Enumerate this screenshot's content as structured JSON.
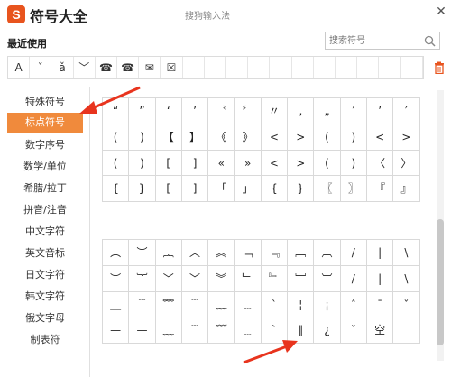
{
  "app": {
    "logo_letter": "S",
    "title": "符号大全",
    "window_title": "搜狗输入法",
    "close_symbol": "✕"
  },
  "recent": {
    "label": "最近使用",
    "items": [
      "A",
      "ˇ",
      "ǎ",
      "﹀",
      "☎",
      "☎",
      "✉",
      "☒",
      "",
      "",
      "",
      "",
      "",
      "",
      "",
      "",
      "",
      "",
      ""
    ]
  },
  "search": {
    "placeholder": "搜索符号"
  },
  "sidebar": {
    "items": [
      {
        "label": "特殊符号",
        "active": false
      },
      {
        "label": "标点符号",
        "active": true
      },
      {
        "label": "数字序号",
        "active": false
      },
      {
        "label": "数学/单位",
        "active": false
      },
      {
        "label": "希腊/拉丁",
        "active": false
      },
      {
        "label": "拼音/注音",
        "active": false
      },
      {
        "label": "中文字符",
        "active": false
      },
      {
        "label": "英文音标",
        "active": false
      },
      {
        "label": "日文字符",
        "active": false
      },
      {
        "label": "韩文字符",
        "active": false
      },
      {
        "label": "俄文字母",
        "active": false
      },
      {
        "label": "制表符",
        "active": false
      }
    ]
  },
  "grid_top": [
    "“",
    "”",
    "‘",
    "’",
    "〝",
    "〞",
    "〃",
    "‚",
    "„",
    "′",
    "’",
    "′",
    "(",
    ")",
    "【",
    "】",
    "《",
    "》",
    "<",
    ">",
    "(",
    ")",
    "<",
    ">",
    "(",
    ")",
    "[",
    "]",
    "«",
    "»",
    "<",
    ">",
    "(",
    ")",
    "〈",
    "〉",
    "{",
    "}",
    "[",
    "]",
    "「",
    "」",
    "{",
    "}",
    "〖",
    "〗",
    "『",
    "』"
  ],
  "grid_bottom": [
    "︵",
    "︶",
    "︷",
    "︿",
    "︽",
    "﹁",
    "﹃",
    "﹇",
    "︹",
    "/",
    "|",
    "\\",
    "︶",
    "︸",
    "﹀",
    "﹀",
    "︾",
    "﹂",
    "﹄",
    "﹈",
    "︺",
    "/",
    "|",
    "\\",
    "＿",
    "﹉",
    "﹌",
    "﹉",
    "﹏",
    "﹍",
    "ˋ",
    "¦",
    "¡",
    "ˆ",
    "ˉ",
    "ˇ",
    "—",
    "—",
    "﹏",
    "﹉",
    "﹌",
    "﹍",
    "ˋ",
    "‖",
    "¿",
    "ˇ",
    "空",
    ""
  ],
  "colors": {
    "accent": "#f08a3c",
    "logo": "#e8541e",
    "arrow": "#e8341e"
  }
}
